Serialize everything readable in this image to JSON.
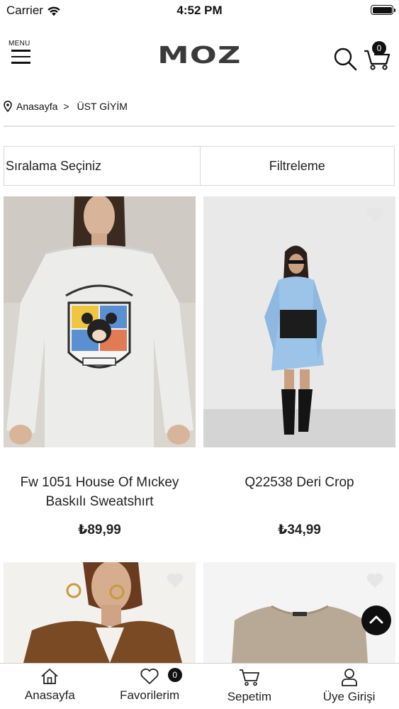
{
  "status_bar": {
    "carrier": "Carrier",
    "time": "4:52 PM"
  },
  "header": {
    "menu_label": "MENU",
    "logo": "MOZ",
    "cart_count": "0"
  },
  "breadcrumb": {
    "home": "Anasayfa",
    "separator": ">",
    "current": "ÜST GİYİM"
  },
  "controls": {
    "sort_label": "Sıralama Seçiniz",
    "filter_label": "Filtreleme"
  },
  "products": [
    {
      "name": "Fw 1051 House Of Mıckey Baskılı Sweatshırt",
      "price": "₺89,99",
      "image_icon": "sweatshirt-photo"
    },
    {
      "name": "Q22538 Deri Crop",
      "price": "₺34,99",
      "image_icon": "model-photo"
    },
    {
      "name": "",
      "price": "",
      "image_icon": "jacket-photo"
    },
    {
      "name": "",
      "price": "",
      "image_icon": "tshirt-photo"
    }
  ],
  "bottom_nav": {
    "items": [
      {
        "label": "Anasayfa",
        "icon": "home-icon"
      },
      {
        "label": "Favorilerim",
        "icon": "heart-icon",
        "badge": "0"
      },
      {
        "label": "Sepetim",
        "icon": "cart-icon"
      },
      {
        "label": "Üye Girişi",
        "icon": "user-icon"
      }
    ]
  },
  "colors": {
    "text": "#111111",
    "badge": "#111111",
    "divider": "#e2e2e2",
    "fav_heart": "#e6e6e6"
  }
}
